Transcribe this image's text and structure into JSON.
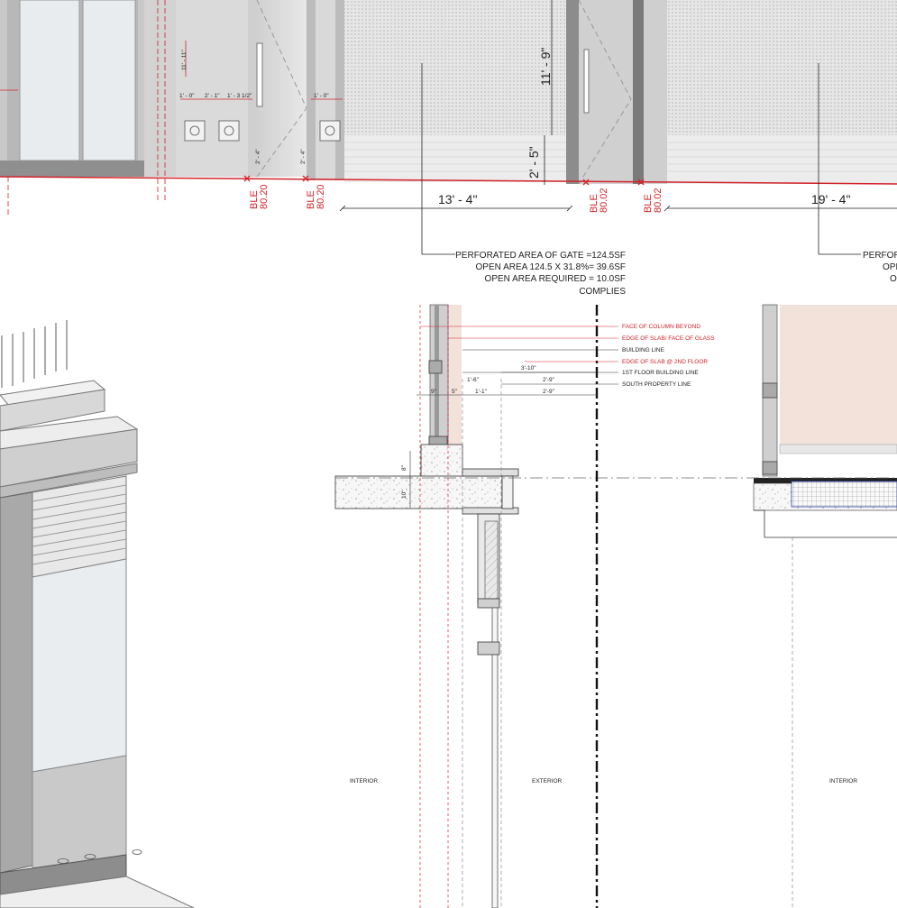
{
  "elevation": {
    "dimensions": [
      "13' - 4\"",
      "19' - 4\"",
      "11' - 9\"",
      "2' - 5\"",
      "11' - 11\"",
      "1' - 0\"",
      "2' - 1\"",
      "1' - 3 1/2\"",
      "2' - 4\"",
      "2' - 4\"",
      "1' - 0\""
    ],
    "ble_tags": [
      {
        "label": "BLE",
        "value": "80.20"
      },
      {
        "label": "BLE",
        "value": "80.20"
      },
      {
        "label": "BLE",
        "value": "80.02"
      },
      {
        "label": "BLE",
        "value": "80.02"
      }
    ],
    "gate_note": [
      "PERFORATED AREA OF GATE =124.5SF",
      "OPEN AREA 124.5 X 31.8%=  39.6SF",
      "OPEN AREA REQUIRED =  10.0SF",
      "COMPLIES"
    ],
    "gate_note_cut": [
      "PERFOR",
      "OPE",
      "O"
    ]
  },
  "section": {
    "leaders": [
      {
        "text": "FACE OF COLUMN BEYOND",
        "color": "#d2232a"
      },
      {
        "text": "EDGE OF SLAB/ FACE OF GLASS",
        "color": "#d2232a"
      },
      {
        "text": "BUILDING LINE",
        "color": "#222222"
      },
      {
        "text": "EDGE OF SLAB @ 2ND FLOOR",
        "color": "#d2232a"
      },
      {
        "text": "1ST FLOOR BUILDING LINE",
        "color": "#222222"
      },
      {
        "text": "SOUTH PROPERTY LINE",
        "color": "#222222"
      }
    ],
    "dims": [
      "3'-10\"",
      "1'-6\"",
      "2'-9\"",
      "9\"",
      "5\"",
      "1'-1\"",
      "2'-9\"",
      "8\"",
      "10\""
    ],
    "labels": {
      "interior_left": "INTERIOR",
      "exterior": "EXTERIOR",
      "interior_right": "INTERIOR"
    }
  }
}
